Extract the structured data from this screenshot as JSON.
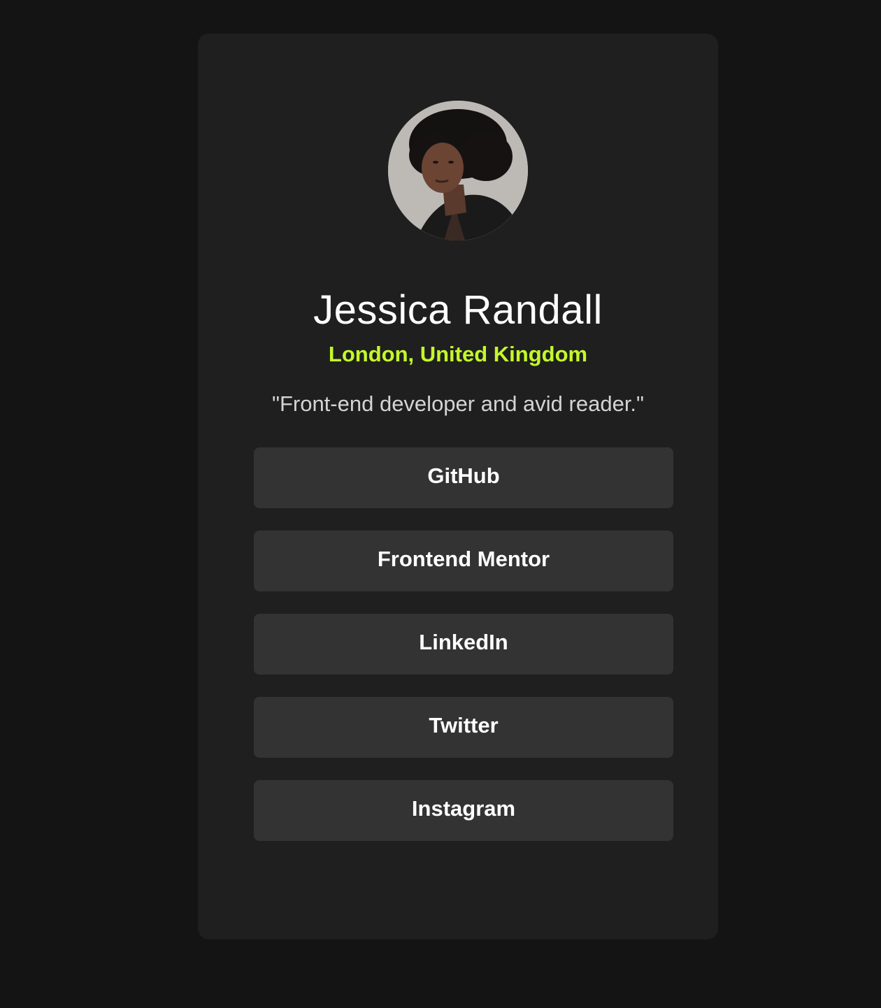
{
  "profile": {
    "name": "Jessica Randall",
    "location": "London, United Kingdom",
    "bio": "\"Front-end developer and avid reader.\""
  },
  "links": [
    {
      "label": "GitHub"
    },
    {
      "label": "Frontend Mentor"
    },
    {
      "label": "LinkedIn"
    },
    {
      "label": "Twitter"
    },
    {
      "label": "Instagram"
    }
  ],
  "colors": {
    "page_background": "#141414",
    "card_background": "#1f1f1f",
    "button_background": "#333333",
    "accent": "#c4f82a",
    "text": "#ffffff",
    "bio_text": "#d4d4d4"
  }
}
